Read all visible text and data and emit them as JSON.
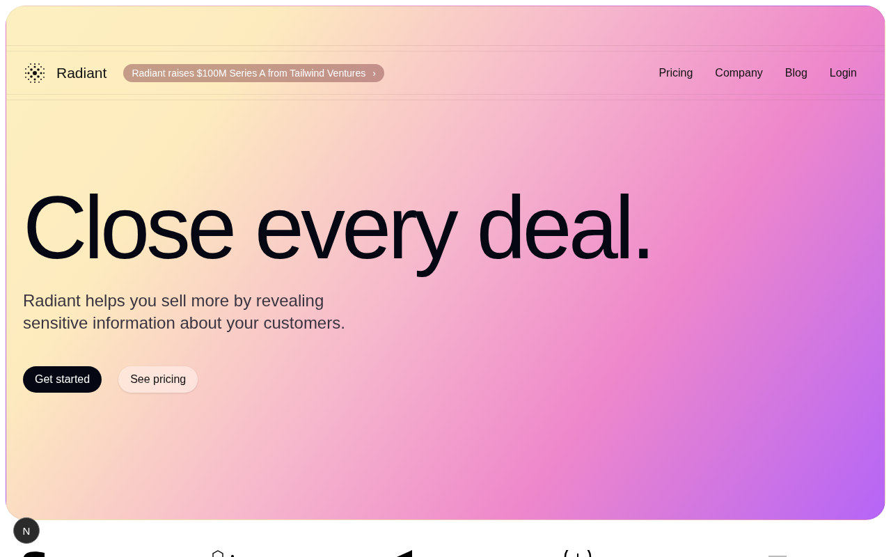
{
  "brand": {
    "name": "Radiant"
  },
  "announcement": {
    "text": "Radiant raises $100M Series A from Tailwind Ventures",
    "chevron": "›"
  },
  "nav": [
    {
      "label": "Pricing"
    },
    {
      "label": "Company"
    },
    {
      "label": "Blog"
    },
    {
      "label": "Login"
    }
  ],
  "hero": {
    "headline": "Close every deal.",
    "subtitle": "Radiant helps you sell more by revealing sensitive information about your customers.",
    "buttons": [
      {
        "label": "Get started",
        "kind": "primary"
      },
      {
        "label": "See pricing",
        "kind": "secondary"
      }
    ]
  },
  "dev_badge": {
    "text": "N"
  }
}
